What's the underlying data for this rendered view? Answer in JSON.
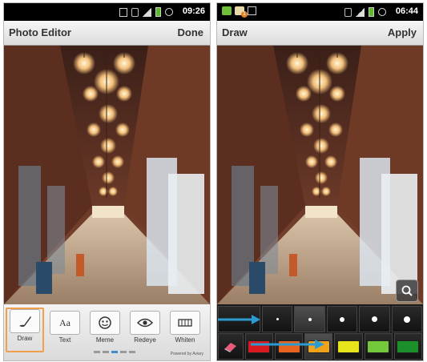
{
  "left_screen": {
    "status": {
      "time": "09:26"
    },
    "title": "Photo Editor",
    "action": "Done",
    "tools": [
      {
        "label": "Draw",
        "icon": "brush-icon",
        "selected": true
      },
      {
        "label": "Text",
        "icon": "text-aa-icon",
        "selected": false
      },
      {
        "label": "Meme",
        "icon": "meme-face-icon",
        "selected": false
      },
      {
        "label": "Redeye",
        "icon": "eye-icon",
        "selected": false
      },
      {
        "label": "Whiten",
        "icon": "teeth-icon",
        "selected": false
      }
    ],
    "page_indicator": {
      "pages": 5,
      "current": 3
    },
    "powered_by": "Powered by Aviary"
  },
  "right_screen": {
    "status": {
      "time": "06:44"
    },
    "title": "Draw",
    "action": "Apply",
    "brush_sizes": [
      1,
      2,
      3,
      4,
      5
    ],
    "selected_brush_size": 2,
    "colors": [
      "#d71920",
      "#e8641e",
      "#f0a21b",
      "#e8e41c",
      "#73c93a",
      "#1a8f2a"
    ],
    "selected_color": "#f0a21b",
    "icons": {
      "eraser": "eraser-icon",
      "zoom": "magnify-icon"
    }
  },
  "accent": {
    "annotation_arrow": "#2b9bd1",
    "selection": "#f0a04a"
  }
}
